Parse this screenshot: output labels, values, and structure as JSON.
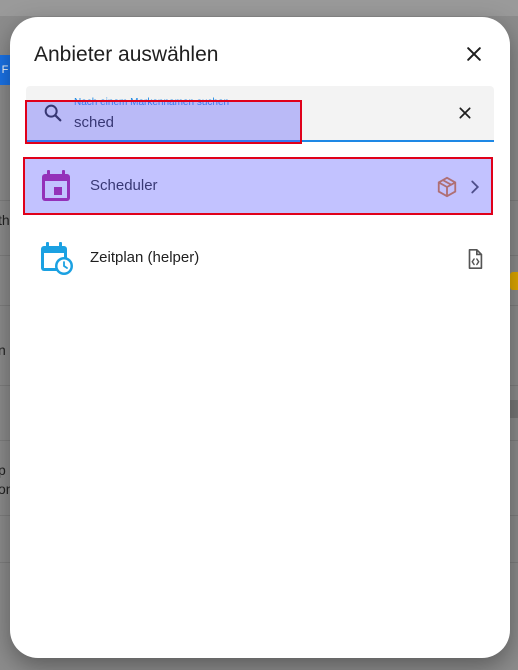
{
  "background": {
    "badge": "F",
    "fragments": [
      "th",
      "n",
      "p",
      "on"
    ]
  },
  "dialog": {
    "title": "Anbieter auswählen",
    "close_icon": "close-icon",
    "search": {
      "label": "Nach einem Markennamen suchen",
      "value": "sched",
      "clear_icon": "close-icon"
    },
    "items": [
      {
        "label": "Scheduler",
        "icon": "calendar-icon",
        "icon_color": "#b5158f",
        "badge_icon": "package-icon",
        "badge_color": "#e07a1f",
        "trailing_icon": "chevron-right-icon"
      },
      {
        "label": "Zeitplan (helper)",
        "icon": "calendar-clock-icon",
        "icon_color": "#1ba1e2",
        "badge_icon": "file-code-icon"
      }
    ]
  },
  "colors": {
    "accent": "#1e88e5",
    "highlight_border": "#e0001a"
  }
}
